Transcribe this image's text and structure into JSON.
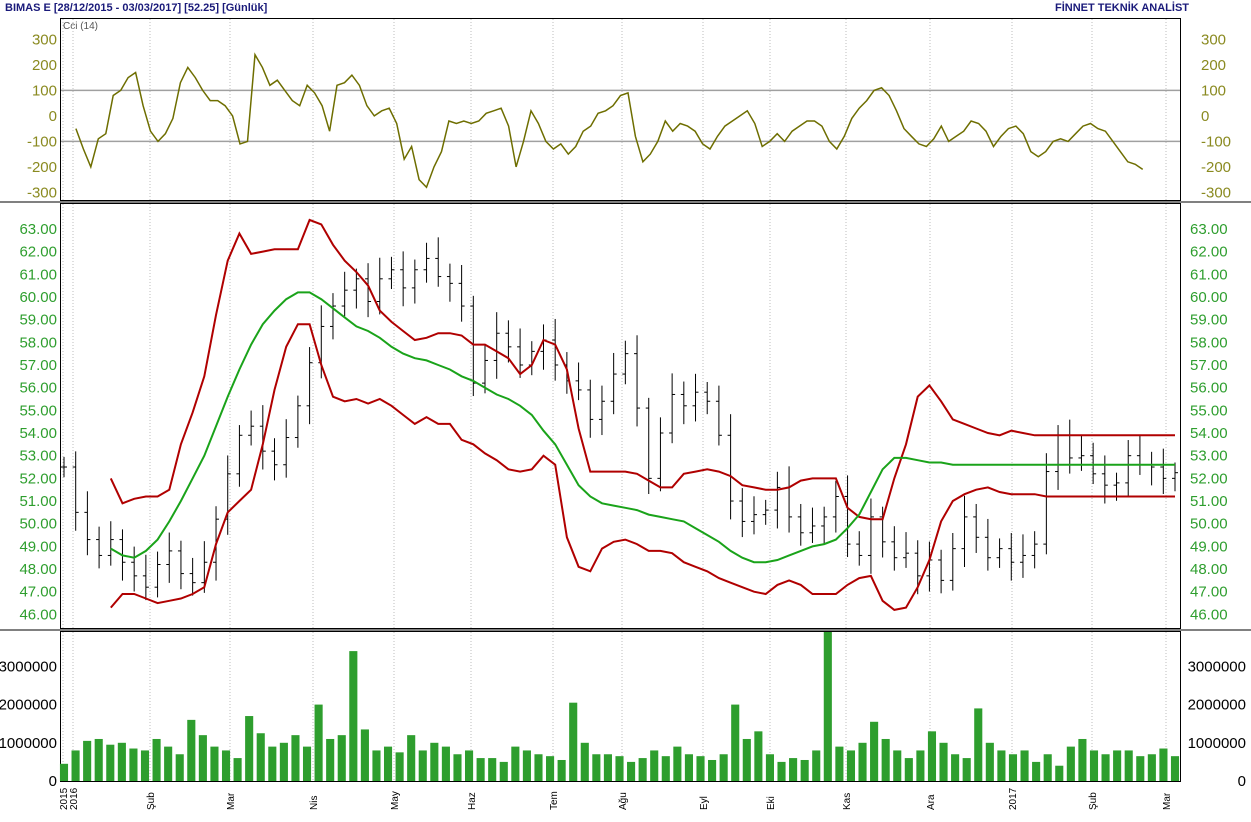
{
  "header": {
    "left": "BIMAS E  [28/12/2015 - 03/03/2017]  [52.25]  [Günlük]",
    "right": "FİNNET TEKNİK ANALİST"
  },
  "colors": {
    "price_bars": "#000000",
    "bollinger_bands": "#b00000",
    "moving_average": "#1aa31a",
    "cci": "#6e6e00",
    "volume": "#2e9e2e",
    "reference_lines": "#a0a0a0"
  },
  "chart_data": [
    {
      "type": "line",
      "legend": "Cci (14)",
      "ylim": [
        -330,
        380
      ],
      "yticks": [
        "300",
        "200",
        "100",
        "0",
        "-100",
        "-200",
        "-300"
      ],
      "reference_lines": [
        100,
        -100
      ],
      "x": [
        4,
        6,
        8,
        10,
        12,
        14,
        16,
        18,
        20,
        22,
        24,
        26,
        28,
        30,
        32,
        34,
        36,
        38,
        40,
        42,
        44,
        46,
        48,
        50,
        52,
        54,
        56,
        58,
        60,
        62,
        64,
        66,
        68,
        70,
        72,
        74,
        76,
        78,
        80,
        82,
        84,
        86,
        88,
        90,
        92,
        94,
        96,
        98,
        100,
        102,
        104,
        106,
        108,
        110,
        112,
        114,
        116,
        118,
        120,
        122,
        124,
        126,
        128,
        130,
        132,
        134,
        136,
        138,
        140,
        142,
        144,
        146,
        148,
        150,
        152,
        154,
        156,
        158,
        160,
        162,
        164,
        166,
        168,
        170,
        172,
        174,
        176,
        178,
        180,
        182,
        184,
        186,
        188,
        190,
        192,
        194,
        196,
        198,
        200,
        202,
        204,
        206,
        208,
        210,
        212,
        214,
        216,
        218,
        220,
        222,
        224,
        226,
        228,
        230,
        232,
        234,
        236,
        238,
        240,
        242,
        244,
        246,
        248,
        250,
        252,
        254,
        256,
        258,
        260,
        262,
        264,
        266,
        268,
        270,
        272,
        274,
        276,
        278,
        280,
        282,
        284,
        286,
        288,
        290,
        292,
        294
      ],
      "values": [
        -50,
        -130,
        -200,
        -90,
        -70,
        80,
        100,
        150,
        170,
        40,
        -60,
        -100,
        -70,
        -10,
        130,
        190,
        150,
        100,
        60,
        60,
        40,
        0,
        -110,
        -100,
        240,
        190,
        120,
        140,
        100,
        60,
        40,
        120,
        90,
        40,
        -60,
        120,
        130,
        160,
        120,
        40,
        0,
        20,
        30,
        -30,
        -170,
        -120,
        -250,
        -280,
        -200,
        -140,
        -20,
        -30,
        -20,
        -30,
        -20,
        10,
        20,
        30,
        -40,
        -200,
        -100,
        20,
        -30,
        -100,
        -130,
        -110,
        -150,
        -120,
        -60,
        -40,
        10,
        20,
        40,
        80,
        90,
        -80,
        -180,
        -150,
        -100,
        -20,
        -60,
        -30,
        -40,
        -60,
        -110,
        -130,
        -80,
        -40,
        -20,
        0,
        20,
        -30,
        -120,
        -100,
        -70,
        -100,
        -60,
        -40,
        -20,
        -20,
        -40,
        -100,
        -130,
        -80,
        -10,
        30,
        60,
        100,
        110,
        80,
        20,
        -50,
        -80,
        -110,
        -120,
        -90,
        -40,
        -100,
        -80,
        -60,
        -20,
        -30,
        -60,
        -120,
        -80,
        -50,
        -40,
        -70,
        -140,
        -160,
        -140,
        -100,
        -90,
        -100,
        -70,
        -40,
        -30,
        -50,
        -60,
        -100,
        -140,
        -180,
        -190,
        -210
      ]
    },
    {
      "type": "line",
      "ylim": [
        45.4,
        64.1
      ],
      "yticks": [
        "63.00",
        "62.00",
        "61.00",
        "60.00",
        "59.00",
        "58.00",
        "57.00",
        "56.00",
        "55.00",
        "54.00",
        "53.00",
        "52.00",
        "51.00",
        "50.00",
        "49.00",
        "48.00",
        "47.00",
        "46.00"
      ],
      "last_close": 52.25,
      "series": [
        {
          "values": [
            52.5,
            50.5,
            49.3,
            48.6,
            49.3,
            48.3,
            47.7,
            47.2,
            48.2,
            48.8,
            47.8,
            47.4,
            48.3,
            50.2,
            52.2,
            53.9,
            54.3,
            53.2,
            52.6,
            53.8,
            55.2,
            57.1,
            58.7,
            59.6,
            60.3,
            60.8,
            59.8,
            60.8,
            61.2,
            60.4,
            61.2,
            61.7,
            60.9,
            60.6,
            59.6,
            56.2,
            57.2,
            58.4,
            57.8,
            57.0,
            57.6,
            58.1,
            57.0,
            56.3,
            55.9,
            54.6,
            55.4,
            56.6,
            57.5,
            55.1,
            52.0,
            54.0,
            55.7,
            55.2,
            55.8,
            55.4,
            53.9,
            51.0,
            50.1,
            50.4,
            50.6,
            51.6,
            50.3,
            49.6,
            49.9,
            50.3,
            51.2,
            49.1,
            48.6,
            50.3,
            49.2,
            48.5,
            48.7,
            47.7,
            48.4,
            47.5,
            48.9,
            50.3,
            49.4,
            48.5,
            48.9,
            48.3,
            48.6,
            49.1,
            52.3,
            53.9,
            52.9,
            53.0,
            52.2,
            51.7,
            51.8,
            53.0,
            52.6,
            52.5,
            52.0,
            52.25
          ]
        },
        {
          "values": [
            null,
            null,
            null,
            null,
            48.9,
            48.6,
            48.5,
            48.8,
            49.3,
            50.1,
            51.0,
            52.0,
            53.0,
            54.3,
            55.6,
            56.8,
            57.9,
            58.8,
            59.4,
            59.9,
            60.2,
            60.2,
            59.9,
            59.5,
            59.1,
            58.7,
            58.5,
            58.2,
            57.8,
            57.5,
            57.3,
            57.2,
            57.0,
            56.8,
            56.5,
            56.3,
            56.0,
            55.7,
            55.5,
            55.2,
            54.8,
            54.1,
            53.5,
            52.6,
            51.7,
            51.2,
            50.9,
            50.8,
            50.7,
            50.6,
            50.4,
            50.3,
            50.2,
            50.1,
            49.8,
            49.5,
            49.2,
            48.8,
            48.5,
            48.3,
            48.3,
            48.4,
            48.6,
            48.8,
            49.0,
            49.1,
            49.3,
            49.8,
            50.4,
            51.4,
            52.4,
            52.9,
            52.9,
            52.8,
            52.7,
            52.7,
            52.6,
            52.6,
            52.6,
            52.6,
            52.6,
            52.6,
            52.6,
            52.6,
            52.6,
            52.6,
            52.6,
            52.6,
            52.6,
            52.6,
            52.6,
            52.6,
            52.6,
            52.6,
            52.6,
            52.6
          ]
        },
        {
          "values": [
            null,
            null,
            null,
            null,
            52.0,
            50.9,
            51.1,
            51.2,
            51.2,
            51.5,
            53.5,
            54.9,
            56.5,
            59.2,
            61.6,
            62.8,
            61.9,
            62.0,
            62.1,
            62.1,
            62.1,
            63.4,
            63.2,
            62.3,
            61.6,
            61.1,
            60.5,
            59.4,
            58.9,
            58.5,
            58.1,
            58.2,
            58.4,
            58.4,
            58.3,
            57.9,
            57.9,
            57.6,
            57.3,
            56.6,
            57.0,
            58.1,
            57.9,
            56.8,
            54.2,
            52.3,
            52.3,
            52.3,
            52.3,
            52.2,
            51.9,
            51.6,
            51.6,
            52.2,
            52.3,
            52.4,
            52.3,
            52.1,
            51.7,
            51.6,
            51.5,
            51.5,
            51.6,
            51.9,
            52.0,
            52.0,
            52.0,
            50.7,
            50.3,
            50.2,
            50.2,
            52.0,
            53.5,
            55.6,
            56.1,
            55.4,
            54.6,
            54.4,
            54.2,
            54.0,
            53.9,
            54.1,
            54.0,
            53.9,
            53.9,
            53.9,
            53.9,
            53.9,
            53.9,
            53.9,
            53.9,
            53.9,
            53.9,
            53.9,
            53.9,
            53.9
          ]
        },
        {
          "values": [
            null,
            null,
            null,
            null,
            46.3,
            46.9,
            46.9,
            46.7,
            46.5,
            46.6,
            46.7,
            46.9,
            47.2,
            49.1,
            50.5,
            51.0,
            51.5,
            53.5,
            55.9,
            57.8,
            58.8,
            58.8,
            57.0,
            55.6,
            55.4,
            55.5,
            55.3,
            55.5,
            55.2,
            54.8,
            54.4,
            54.7,
            54.4,
            54.4,
            53.7,
            53.5,
            53.1,
            52.8,
            52.4,
            52.3,
            52.4,
            53.0,
            52.6,
            49.4,
            48.1,
            47.9,
            48.9,
            49.2,
            49.3,
            49.1,
            48.8,
            48.8,
            48.7,
            48.3,
            48.1,
            47.9,
            47.6,
            47.4,
            47.2,
            47.0,
            46.9,
            47.3,
            47.5,
            47.3,
            46.9,
            46.9,
            46.9,
            47.3,
            47.6,
            47.7,
            46.6,
            46.2,
            46.3,
            47.2,
            48.4,
            50.1,
            51.0,
            51.3,
            51.5,
            51.6,
            51.4,
            51.3,
            51.3,
            51.3,
            51.2,
            51.2,
            51.2,
            51.2,
            51.2,
            51.2,
            51.2,
            51.2,
            51.2,
            51.2,
            51.2,
            51.2
          ]
        }
      ]
    },
    {
      "type": "bar",
      "ylim": [
        0,
        3900000
      ],
      "yticks": [
        "3000000",
        "2000000",
        "1000000",
        "0"
      ],
      "values": [
        450000,
        800000,
        1050000,
        1100000,
        950000,
        1000000,
        850000,
        800000,
        1100000,
        900000,
        700000,
        1600000,
        1200000,
        900000,
        800000,
        600000,
        1700000,
        1250000,
        900000,
        1000000,
        1200000,
        900000,
        2000000,
        1100000,
        1200000,
        3400000,
        1350000,
        800000,
        900000,
        750000,
        1200000,
        800000,
        1000000,
        900000,
        700000,
        800000,
        600000,
        600000,
        500000,
        900000,
        800000,
        700000,
        650000,
        550000,
        2050000,
        1000000,
        700000,
        700000,
        650000,
        500000,
        600000,
        800000,
        650000,
        900000,
        700000,
        650000,
        550000,
        700000,
        2000000,
        1100000,
        1300000,
        700000,
        500000,
        600000,
        550000,
        800000,
        3900000,
        900000,
        800000,
        1000000,
        1550000,
        1100000,
        800000,
        600000,
        800000,
        1300000,
        1000000,
        700000,
        600000,
        1900000,
        1000000,
        800000,
        700000,
        800000,
        500000,
        700000,
        400000,
        900000,
        1100000,
        800000,
        700000,
        800000,
        800000,
        650000,
        700000,
        850000,
        650000
      ]
    }
  ],
  "x_axis": {
    "labels": [
      "2015",
      "2016",
      "Şub",
      "Mar",
      "Nis",
      "May",
      "Haz",
      "Tem",
      "Ağu",
      "Eyl",
      "Eki",
      "Kas",
      "Ara",
      "2017",
      "Şub",
      "Mar"
    ]
  }
}
